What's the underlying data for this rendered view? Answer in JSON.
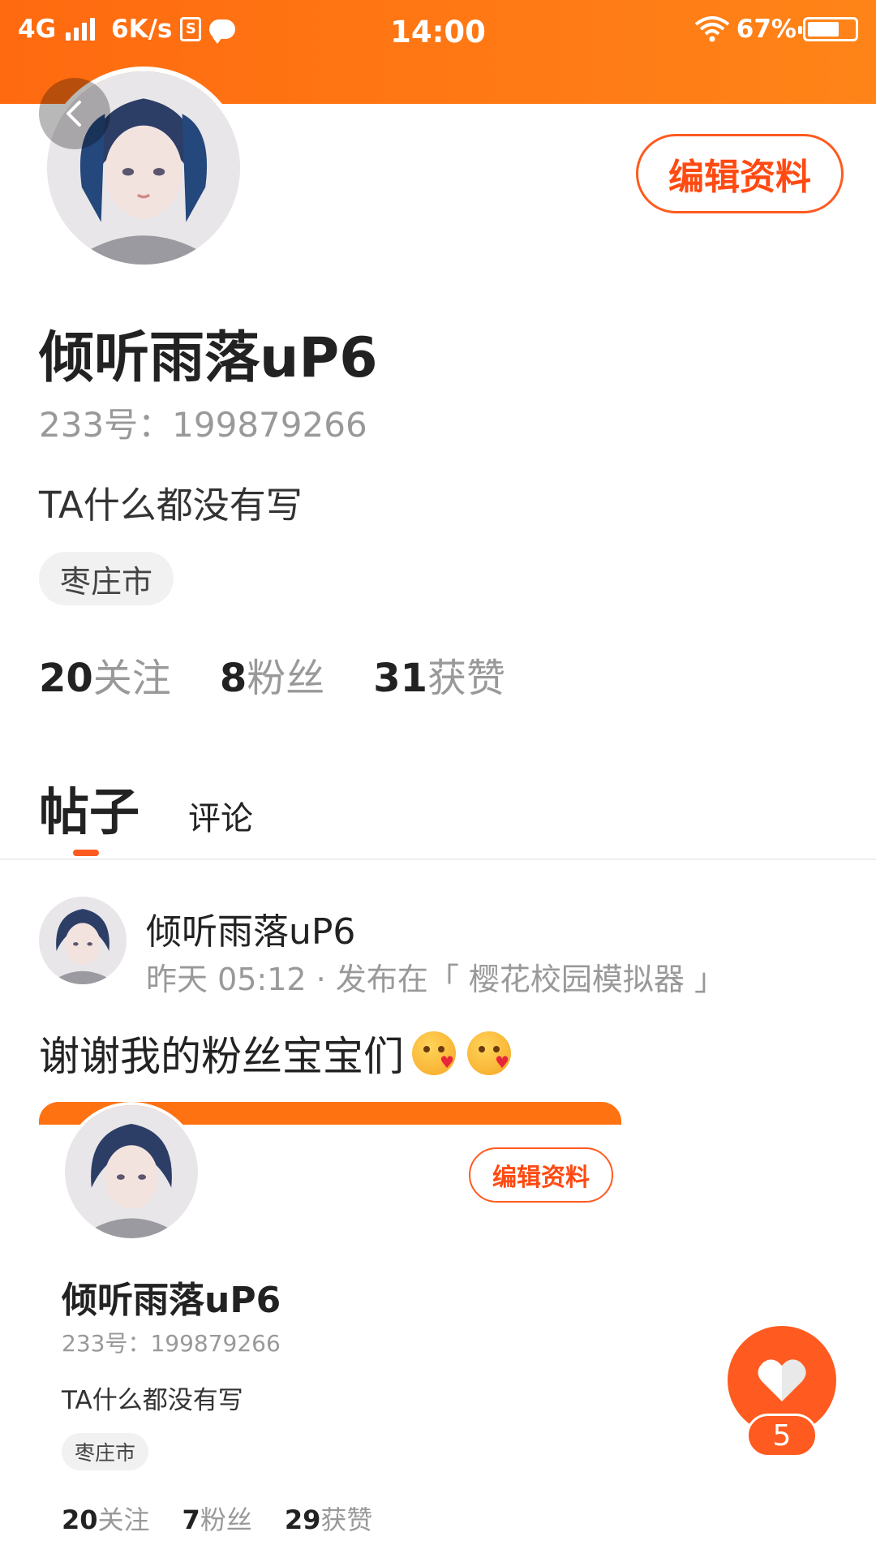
{
  "status_bar": {
    "network": "4G",
    "speed": "6K/s",
    "s_badge": "S",
    "time": "14:00",
    "battery": "67%",
    "battery_level": 0.67
  },
  "profile": {
    "username": "倾听雨落uP6",
    "user_id": "233号：199879266",
    "bio": "TA什么都没有写",
    "location_tag": "枣庄市",
    "edit_button": "编辑资料",
    "stats": [
      {
        "num": "20",
        "label": "关注"
      },
      {
        "num": "8",
        "label": "粉丝"
      },
      {
        "num": "31",
        "label": "获赞"
      }
    ]
  },
  "tabs": {
    "active": "帖子",
    "other": "评论"
  },
  "post": {
    "author": "倾听雨落uP6",
    "meta": "昨天 05:12 · 发布在「 樱花校园模拟器 」",
    "text": "谢谢我的粉丝宝宝们",
    "emoji": [
      "kiss-emoji",
      "kiss-emoji"
    ]
  },
  "post_image": {
    "username": "倾听雨落uP6",
    "user_id": "233号：199879266",
    "bio": "TA什么都没有写",
    "location_tag": "枣庄市",
    "edit_button": "编辑资料",
    "stats": [
      {
        "num": "20",
        "label": "关注"
      },
      {
        "num": "7",
        "label": "粉丝"
      },
      {
        "num": "29",
        "label": "获赞"
      }
    ]
  },
  "like_button": {
    "icon": "heart-icon",
    "count": "5"
  },
  "colors": {
    "accent": "#ff5a1f",
    "status_bar": "#ff7212"
  }
}
